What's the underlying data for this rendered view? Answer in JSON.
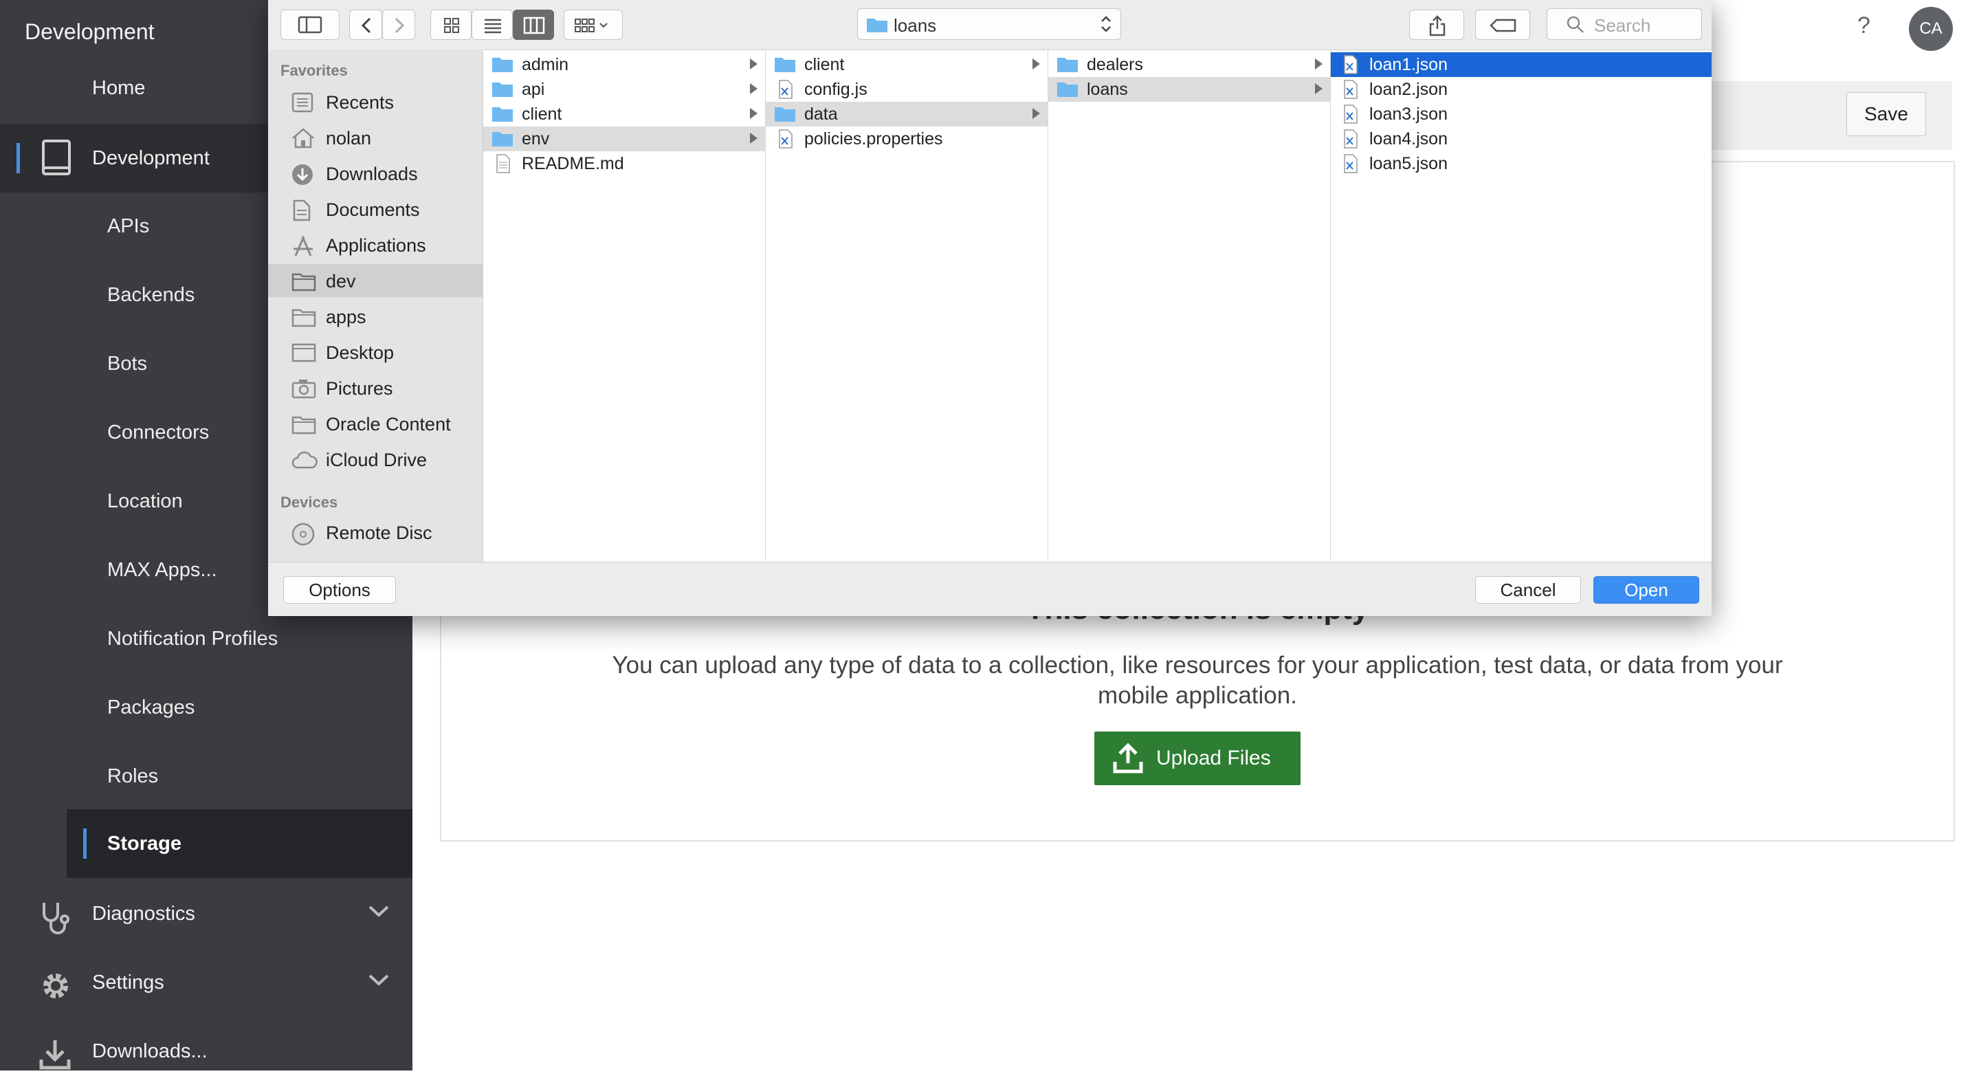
{
  "app": {
    "title": "Development",
    "user_initials": "CA",
    "help_glyph": "?"
  },
  "sidebar": {
    "home": "Home",
    "section": "Development",
    "items": [
      {
        "label": "APIs"
      },
      {
        "label": "Backends"
      },
      {
        "label": "Bots"
      },
      {
        "label": "Connectors"
      },
      {
        "label": "Location"
      },
      {
        "label": "MAX Apps..."
      },
      {
        "label": "Notification Profiles"
      },
      {
        "label": "Packages"
      },
      {
        "label": "Roles"
      }
    ],
    "active_item": "Storage",
    "groups": [
      {
        "label": "Diagnostics",
        "icon": "stethoscope-icon"
      },
      {
        "label": "Settings",
        "icon": "gear-icon"
      },
      {
        "label": "Downloads...",
        "icon": "download-icon"
      }
    ]
  },
  "main": {
    "save_label": "Save",
    "empty_title": "This collection is empty",
    "empty_description": "You can upload any type of data to a collection, like resources for your application, test data, or data from your mobile application.",
    "upload_label": "Upload Files"
  },
  "dialog": {
    "current_folder": "loans",
    "search_placeholder": "Search",
    "favorites_heading": "Favorites",
    "favorites": [
      {
        "label": "Recents",
        "icon": "recents-icon"
      },
      {
        "label": "nolan",
        "icon": "home-icon"
      },
      {
        "label": "Downloads",
        "icon": "downloads-icon"
      },
      {
        "label": "Documents",
        "icon": "documents-icon"
      },
      {
        "label": "Applications",
        "icon": "applications-icon"
      },
      {
        "label": "dev",
        "icon": "folder-icon"
      },
      {
        "label": "apps",
        "icon": "folder-icon"
      },
      {
        "label": "Desktop",
        "icon": "desktop-icon"
      },
      {
        "label": "Pictures",
        "icon": "camera-icon"
      },
      {
        "label": "Oracle Content",
        "icon": "folder-icon"
      },
      {
        "label": "iCloud Drive",
        "icon": "cloud-icon"
      }
    ],
    "selected_favorite": "dev",
    "devices_heading": "Devices",
    "devices": [
      {
        "label": "Remote Disc",
        "icon": "disc-icon"
      }
    ],
    "columns": [
      {
        "items": [
          {
            "name": "admin",
            "type": "folder"
          },
          {
            "name": "api",
            "type": "folder"
          },
          {
            "name": "client",
            "type": "folder"
          },
          {
            "name": "env",
            "type": "folder"
          },
          {
            "name": "README.md",
            "type": "text"
          }
        ],
        "selected": "env"
      },
      {
        "items": [
          {
            "name": "client",
            "type": "folder"
          },
          {
            "name": "config.js",
            "type": "code"
          },
          {
            "name": "data",
            "type": "folder"
          },
          {
            "name": "policies.properties",
            "type": "code"
          }
        ],
        "selected": "data"
      },
      {
        "items": [
          {
            "name": "dealers",
            "type": "folder"
          },
          {
            "name": "loans",
            "type": "folder"
          }
        ],
        "selected": "loans"
      },
      {
        "items": [
          {
            "name": "loan1.json",
            "type": "code"
          },
          {
            "name": "loan2.json",
            "type": "code"
          },
          {
            "name": "loan3.json",
            "type": "code"
          },
          {
            "name": "loan4.json",
            "type": "code"
          },
          {
            "name": "loan5.json",
            "type": "code"
          }
        ],
        "selected": "loan1.json"
      }
    ],
    "options_label": "Options",
    "cancel_label": "Cancel",
    "open_label": "Open"
  },
  "colors": {
    "sidebar_bg": "#3a3c40",
    "accent_blue": "#4a90e2",
    "finder_selection": "#1b66d6",
    "upload_green": "#2d7d32",
    "open_button": "#3b8ef2"
  }
}
